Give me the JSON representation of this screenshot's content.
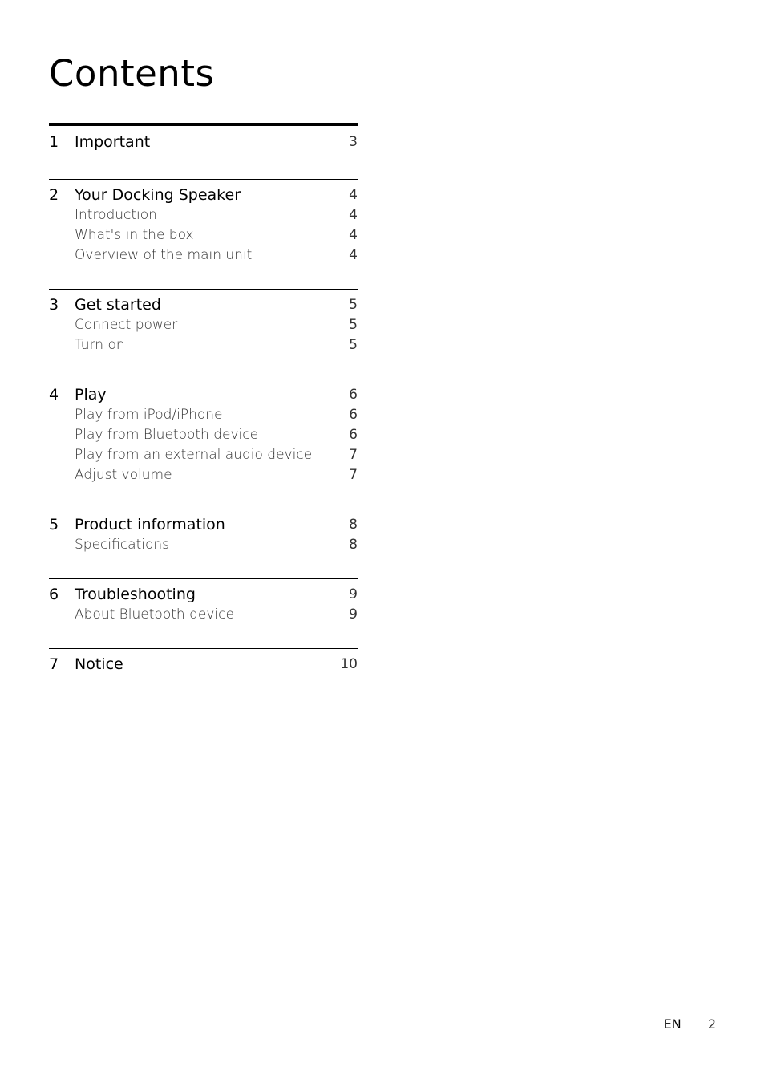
{
  "title": "Contents",
  "sections": [
    {
      "number": "1",
      "title": "Important",
      "page": "3",
      "items": []
    },
    {
      "number": "2",
      "title": "Your Docking Speaker",
      "page": "4",
      "items": [
        {
          "label": "Introduction",
          "page": "4"
        },
        {
          "label": "What's in the box",
          "page": "4"
        },
        {
          "label": "Overview of the main unit",
          "page": "4"
        }
      ]
    },
    {
      "number": "3",
      "title": "Get started",
      "page": "5",
      "items": [
        {
          "label": "Connect power",
          "page": "5"
        },
        {
          "label": "Turn on",
          "page": "5"
        }
      ]
    },
    {
      "number": "4",
      "title": "Play",
      "page": "6",
      "items": [
        {
          "label": "Play from iPod/iPhone",
          "page": "6"
        },
        {
          "label": "Play from Bluetooth device",
          "page": "6"
        },
        {
          "label": "Play from an external audio device",
          "page": "7"
        },
        {
          "label": "Adjust volume",
          "page": "7"
        }
      ]
    },
    {
      "number": "5",
      "title": "Product information",
      "page": "8",
      "items": [
        {
          "label": "Specifications",
          "page": "8"
        }
      ]
    },
    {
      "number": "6",
      "title": "Troubleshooting",
      "page": "9",
      "items": [
        {
          "label": "About Bluetooth device",
          "page": "9"
        }
      ]
    },
    {
      "number": "7",
      "title": "Notice",
      "page": "10",
      "items": []
    }
  ],
  "footer": {
    "language": "EN",
    "page_number": "2"
  }
}
